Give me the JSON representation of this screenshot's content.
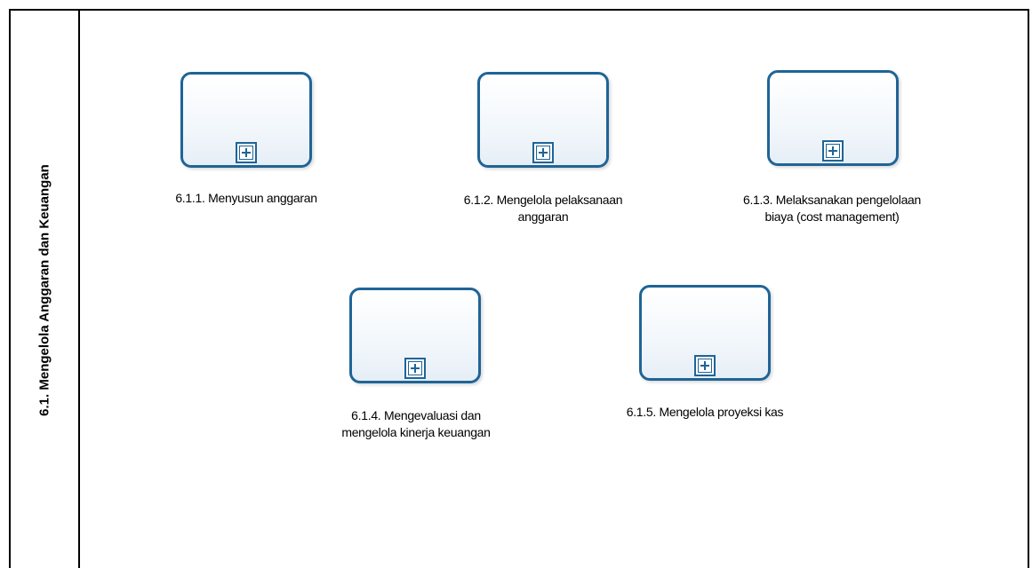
{
  "lane": {
    "title": "6.1. Mengelola Anggaran dan Keuangan"
  },
  "tasks": [
    {
      "id": "6.1.1",
      "label": "6.1.1. Menyusun anggaran",
      "marker_icon": "plus-square-icon"
    },
    {
      "id": "6.1.2",
      "label_line1": "6.1.2. Mengelola pelaksanaan",
      "label_line2": "anggaran",
      "marker_icon": "plus-square-icon"
    },
    {
      "id": "6.1.3",
      "label_line1": "6.1.3. Melaksanakan pengelolaan",
      "label_line2": "biaya (cost management)",
      "marker_icon": "plus-square-icon"
    },
    {
      "id": "6.1.4",
      "label_line1": "6.1.4. Mengevaluasi dan",
      "label_line2": "mengelola kinerja keuangan",
      "marker_icon": "plus-square-icon"
    },
    {
      "id": "6.1.5",
      "label": "6.1.5. Mengelola proyeksi kas",
      "marker_icon": "plus-square-icon"
    }
  ],
  "colors": {
    "task_border": "#1f6497",
    "pool_border": "#000000",
    "background": "#ffffff"
  }
}
